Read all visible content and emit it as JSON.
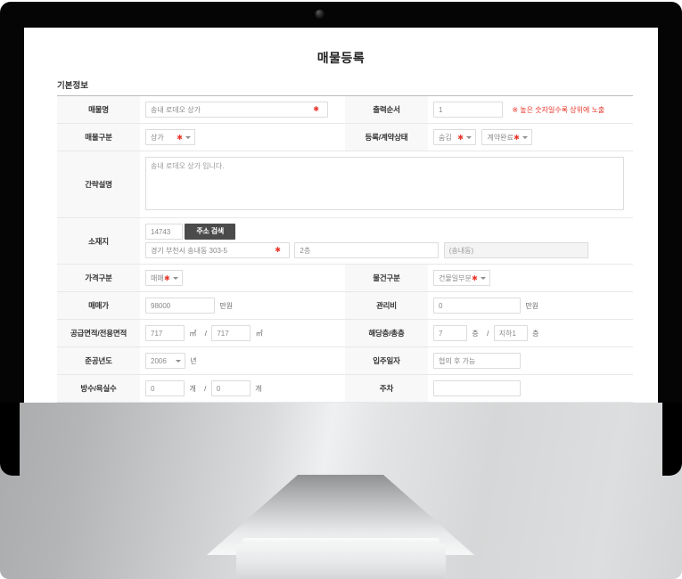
{
  "device": {
    "type": "desktop-monitor",
    "webcam": "webcam-dot"
  },
  "page": {
    "title": "매물등록",
    "section_title": "기본정보"
  },
  "required_marker": "✱",
  "colors": {
    "required_red": "#e8342a",
    "button_dark": "#4b4b4b",
    "label_bg": "#f8f8f9",
    "border": "#dcdcdc",
    "table_top_border": "#bdbdbd"
  },
  "rows": {
    "name": {
      "label": "매물명",
      "value": "송내 로데오 상가",
      "placeholder": "매물명"
    },
    "order": {
      "label": "출력순서",
      "value": "1",
      "note": "※ 높은 숫자일수록 상위에 노출"
    },
    "category": {
      "label": "매물구분",
      "value": "상가"
    },
    "status": {
      "label": "등록/계약상태",
      "value1": "숨김",
      "value2": "계약완료"
    },
    "description": {
      "label": "간략설명",
      "value": "송내 로데오 상가 입니다."
    },
    "address": {
      "label": "소재지",
      "zip": "14743",
      "search_button": "주소 검색",
      "line1": "경기 부천시 송내동 303-5",
      "line2": "2층",
      "line3": "(송내동)"
    },
    "price_type": {
      "label": "가격구분",
      "value": "매매"
    },
    "property_type": {
      "label": "물건구분",
      "value": "건물일부분"
    },
    "sale_price": {
      "label": "매매가",
      "value": "98000",
      "unit": "만원"
    },
    "maintenance_fee": {
      "label": "관리비",
      "value": "0",
      "unit": "만원"
    },
    "area": {
      "label": "공급면적/전용면적",
      "supply": "717",
      "supply_unit": "㎡",
      "slash": "/",
      "exclusive": "717",
      "exclusive_unit": "㎡"
    },
    "floor": {
      "label": "해당층/총층",
      "current": "7",
      "current_unit": "층",
      "slash": "/",
      "total": "지하1",
      "total_unit": "층"
    },
    "build_year": {
      "label": "준공년도",
      "value": "2006",
      "unit": "년"
    },
    "move_in": {
      "label": "입주일자",
      "value": "협의 후 가능"
    },
    "rooms": {
      "label": "방수/욕실수",
      "rooms": "0",
      "rooms_unit": "개",
      "slash": "/",
      "baths": "0",
      "baths_unit": "개"
    },
    "parking": {
      "label": "주차",
      "value": ""
    }
  }
}
